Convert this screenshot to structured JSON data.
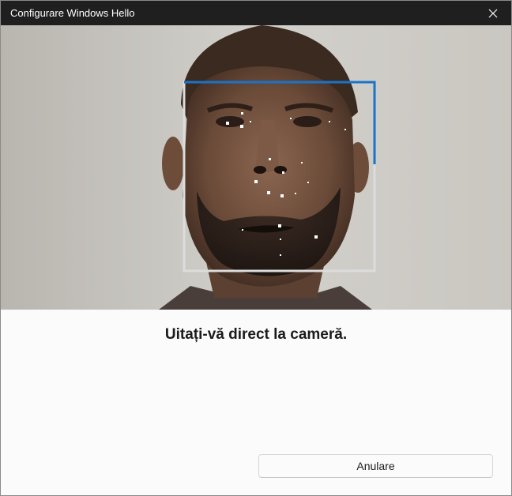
{
  "window": {
    "title": "Configurare Windows Hello"
  },
  "icons": {
    "close": "close-icon"
  },
  "camera": {
    "description_icon": "face-scan"
  },
  "colors": {
    "tracking_frame_active": "#1a73c9",
    "tracking_frame": "#dcdcdc",
    "titlebar": "#1f1f1f"
  },
  "main": {
    "instruction": "Uitați-vă direct la cameră."
  },
  "buttons": {
    "cancel_label": "Anulare"
  }
}
